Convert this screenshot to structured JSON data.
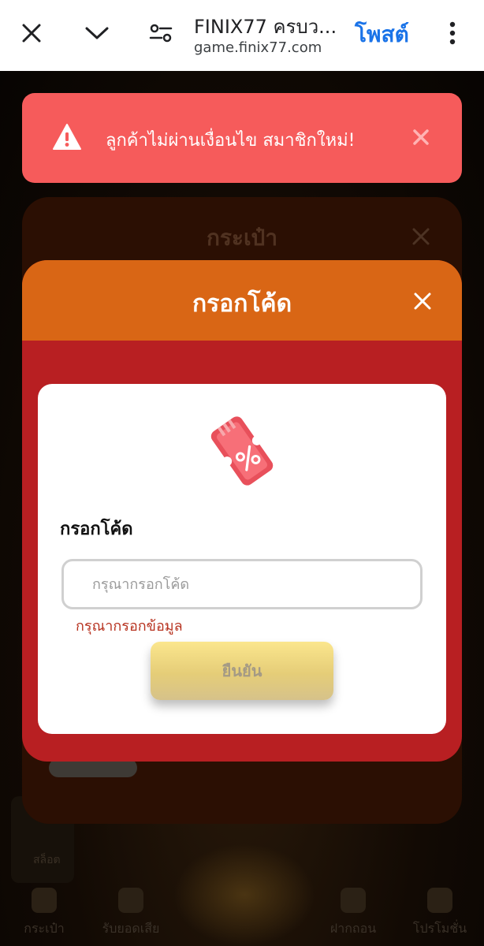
{
  "browser": {
    "title": "FINIX77 ครบว...",
    "url": "game.finix77.com",
    "post_label": "โพสต์"
  },
  "alert": {
    "message": "ลูกค้าไม่ผ่านเงื่อนไข สมาชิกใหม่!",
    "color": "#f65b5b"
  },
  "wallet_modal": {
    "title": "กระเป๋า"
  },
  "redeem_modal": {
    "title": "กรอกโค้ด",
    "header_color": "#d96615",
    "body_color": "#b81f22",
    "field_label": "กรอกโค้ด",
    "input_placeholder": "กรุณากรอกโค้ด",
    "input_value": "",
    "error_message": "กรุณากรอกข้อมูล",
    "confirm_label": "ยืนยัน"
  },
  "bottom_nav": {
    "items": [
      {
        "label": "กระเป๋า",
        "icon": "wallet-icon"
      },
      {
        "label": "รับยอดเสีย",
        "icon": "gift-icon"
      },
      {
        "label": "ฝากถอน",
        "icon": "deposit-icon"
      },
      {
        "label": "โปรโมชั่น",
        "icon": "promo-icon"
      }
    ]
  },
  "side_card": {
    "line1": "สล็อต"
  }
}
